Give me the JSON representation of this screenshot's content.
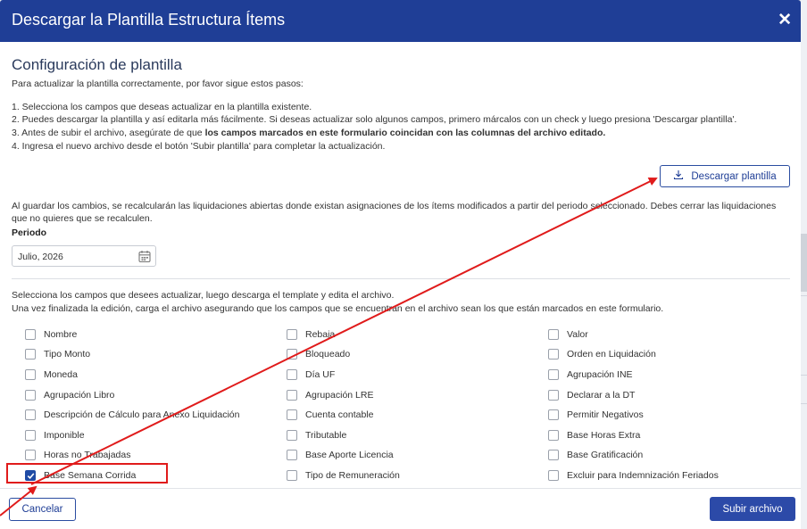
{
  "dialog": {
    "title": "Descargar la Plantilla Estructura Ítems",
    "close_icon": "close-icon"
  },
  "config": {
    "heading": "Configuración de plantilla",
    "intro": "Para actualizar la plantilla correctamente, por favor sigue estos pasos:",
    "step1": "1. Selecciona los campos que deseas actualizar en la plantilla existente.",
    "step2": "2. Puedes descargar la plantilla y así editarla más fácilmente. Si deseas actualizar solo algunos campos, primero márcalos con un check y luego presiona 'Descargar plantilla'.",
    "step3_prefix": "3. Antes de subir el archivo, asegúrate de que ",
    "step3_bold": "los campos marcados en este formulario coincidan con las columnas del archivo editado.",
    "step4": "4. Ingresa el nuevo archivo desde el botón 'Subir plantilla' para completar la actualización.",
    "download_button": "Descargar plantilla",
    "download_icon": "download-icon",
    "warning": "Al guardar los cambios, se recalcularán las liquidaciones abiertas donde existan asignaciones de los ítems modificados a partir del periodo seleccionado. Debes cerrar las liquidaciones que no quieres que se recalculen."
  },
  "period": {
    "label": "Periodo",
    "value": "Julio, 2026",
    "calendar_icon": "calendar-icon"
  },
  "fields": {
    "instruction1": "Selecciona los campos que desees actualizar, luego descarga el template y edita el archivo.",
    "instruction2": "Una vez finalizada la edición, carga el archivo asegurando que los campos que se encuentran en el archivo sean los que están marcados en este formulario.",
    "columns": [
      [
        {
          "label": "Nombre",
          "checked": false
        },
        {
          "label": "Tipo Monto",
          "checked": false
        },
        {
          "label": "Moneda",
          "checked": false
        },
        {
          "label": "Agrupación Libro",
          "checked": false
        },
        {
          "label": "Descripción de Cálculo para Anexo Liquidación",
          "checked": false
        },
        {
          "label": "Imponible",
          "checked": false
        },
        {
          "label": "Horas no Trabajadas",
          "checked": false
        },
        {
          "label": "Base Semana Corrida",
          "checked": true
        }
      ],
      [
        {
          "label": "Rebaja",
          "checked": false
        },
        {
          "label": "Bloqueado",
          "checked": false
        },
        {
          "label": "Día UF",
          "checked": false
        },
        {
          "label": "Agrupación LRE",
          "checked": false
        },
        {
          "label": "Cuenta contable",
          "checked": false
        },
        {
          "label": "Tributable",
          "checked": false
        },
        {
          "label": "Base Aporte Licencia",
          "checked": false
        },
        {
          "label": "Tipo de Remuneración",
          "checked": false
        }
      ],
      [
        {
          "label": "Valor",
          "checked": false
        },
        {
          "label": "Orden en Liquidación",
          "checked": false
        },
        {
          "label": "Agrupación INE",
          "checked": false
        },
        {
          "label": "Declarar a la DT",
          "checked": false
        },
        {
          "label": "Permitir Negativos",
          "checked": false
        },
        {
          "label": "Base Horas Extra",
          "checked": false
        },
        {
          "label": "Base Gratificación",
          "checked": false
        },
        {
          "label": "Excluir para Indemnización Feriados",
          "checked": false
        }
      ]
    ]
  },
  "footer": {
    "cancel": "Cancelar",
    "submit": "Subir archivo"
  },
  "colors": {
    "header": "#1f3e96",
    "primary": "#2c4aa8",
    "annotation": "#e01b1b"
  }
}
